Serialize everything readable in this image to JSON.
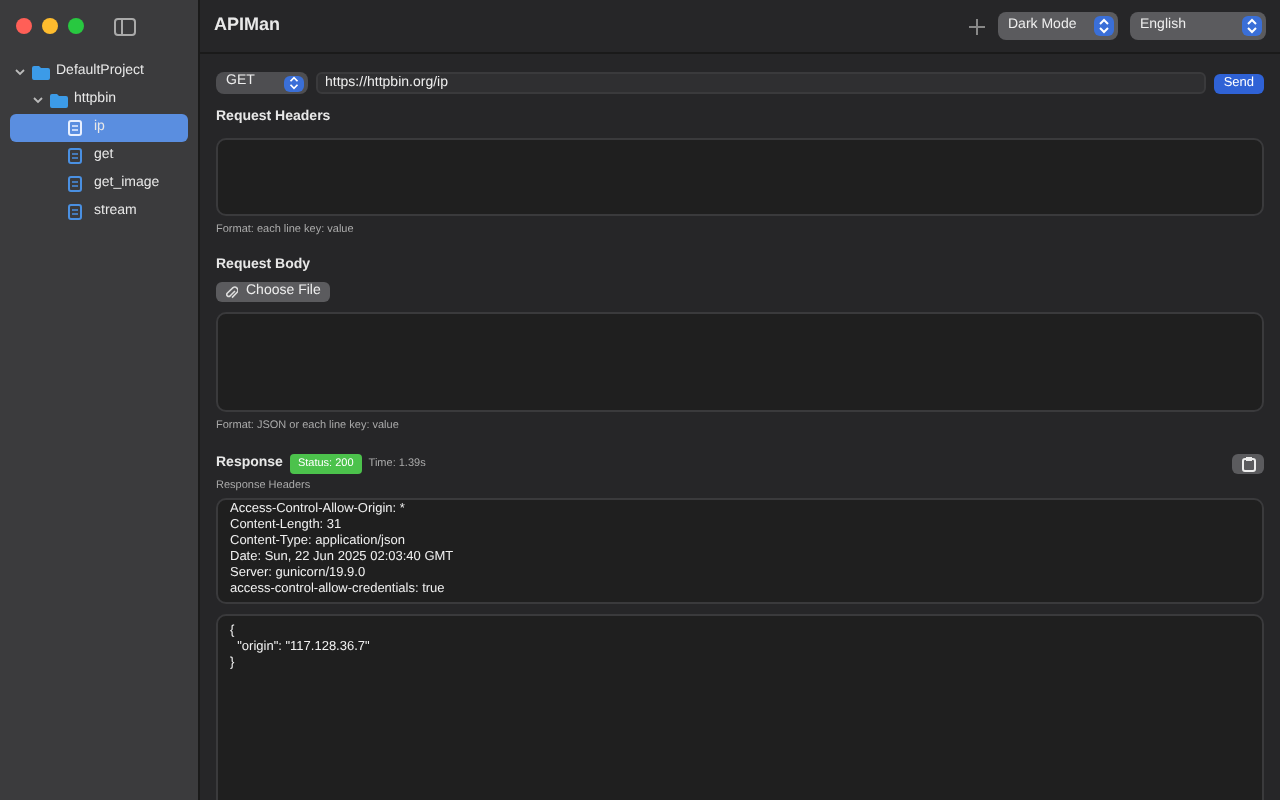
{
  "window": {
    "title": "APIMan"
  },
  "toolbar": {
    "theme": "Dark Mode",
    "language": "English"
  },
  "sidebar": {
    "tree": [
      {
        "label": "DefaultProject",
        "kind": "folder",
        "expanded": true,
        "selected": false,
        "children": [
          {
            "label": "httpbin",
            "kind": "folder",
            "expanded": true,
            "selected": false,
            "children": [
              {
                "label": "ip",
                "kind": "request",
                "selected": true
              },
              {
                "label": "get",
                "kind": "request",
                "selected": false
              },
              {
                "label": "get_image",
                "kind": "request",
                "selected": false
              },
              {
                "label": "stream",
                "kind": "request",
                "selected": false
              }
            ]
          }
        ]
      }
    ]
  },
  "request": {
    "method": "GET",
    "url": "https://httpbin.org/ip",
    "send": "Send",
    "headers_label": "Request Headers",
    "headers_hint": "Format: each line key: value",
    "body_label": "Request Body",
    "choose_file": "Choose File",
    "body_hint": "Format: JSON or each line key: value"
  },
  "response": {
    "label": "Response",
    "status": "Status: 200",
    "time": "Time: 1.39s",
    "headers_label": "Response Headers",
    "headers": [
      "Access-Control-Allow-Origin: *",
      "Content-Length: 31",
      "Content-Type: application/json",
      "Date: Sun, 22 Jun 2025 02:03:40 GMT",
      "Server: gunicorn/19.9.0",
      "access-control-allow-credentials: true"
    ],
    "body": [
      "{",
      "  \"origin\": \"117.128.36.7\"",
      "}"
    ]
  }
}
